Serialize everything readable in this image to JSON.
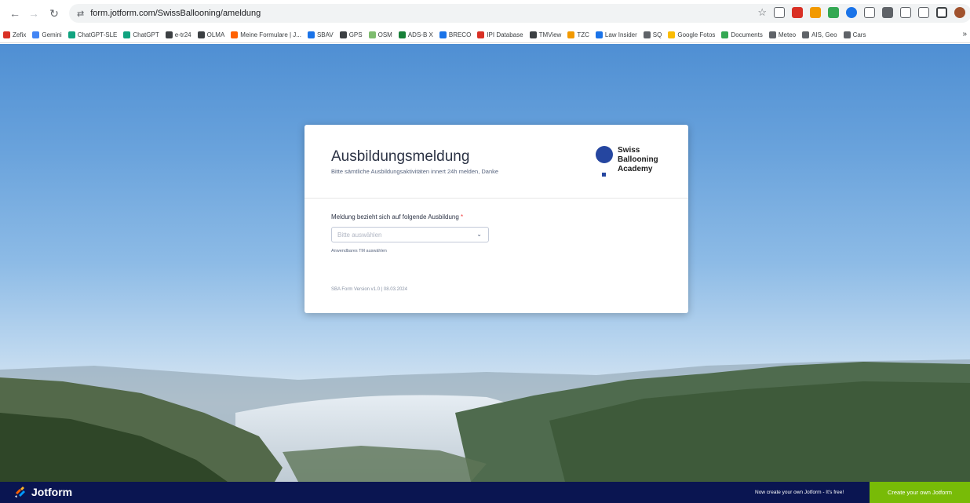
{
  "browser": {
    "url": "form.jotform.com/SwissBallooning/ameldung",
    "bookmarks": [
      {
        "label": "Zefix",
        "color": "#d93025"
      },
      {
        "label": "Gemini",
        "color": "#4285f4"
      },
      {
        "label": "ChatGPT-SLE",
        "color": "#10a37f"
      },
      {
        "label": "ChatGPT",
        "color": "#10a37f"
      },
      {
        "label": "e-tr24",
        "color": "#3c4043"
      },
      {
        "label": "OLMA",
        "color": "#3c4043"
      },
      {
        "label": "Meine Formulare | J...",
        "color": "#ff6100"
      },
      {
        "label": "SBAV",
        "color": "#1a73e8"
      },
      {
        "label": "GPS",
        "color": "#3c4043"
      },
      {
        "label": "OSM",
        "color": "#7ebc6f"
      },
      {
        "label": "ADS-B X",
        "color": "#188038"
      },
      {
        "label": "BRECO",
        "color": "#1a73e8"
      },
      {
        "label": "IPI Database",
        "color": "#d93025"
      },
      {
        "label": "TMView",
        "color": "#3c4043"
      },
      {
        "label": "TZC",
        "color": "#f29900"
      },
      {
        "label": "Law Insider",
        "color": "#1a73e8"
      },
      {
        "label": "SQ",
        "color": "#5f6368"
      },
      {
        "label": "Google Fotos",
        "color": "#fbbc04"
      },
      {
        "label": "Documents",
        "color": "#34a853"
      },
      {
        "label": "Meteo",
        "color": "#5f6368"
      },
      {
        "label": "AIS, Geo",
        "color": "#5f6368"
      },
      {
        "label": "Cars",
        "color": "#5f6368"
      }
    ],
    "more_label": "»"
  },
  "form": {
    "title": "Ausbildungsmeldung",
    "subtitle": "Bitte sämtliche Ausbildungsaktivitäten innert 24h melden, Danke",
    "logo_lines": [
      "Swiss",
      "Ballooning",
      "Academy"
    ],
    "field_label": "Meldung bezieht sich auf folgende Ausbildung",
    "required_mark": "*",
    "select_placeholder": "Bitte auswählen",
    "field_hint": "Anwendbares TM auswählen",
    "version": "SBA Form Version v1.0 | 08.03.2024"
  },
  "footer": {
    "brand": "Jotform",
    "promo_text": "Now create your own Jotform - It's free!",
    "cta_label": "Create your own Jotform"
  },
  "colors": {
    "brand_blue": "#2546a0",
    "jotform_navy": "#0a1551",
    "cta_green": "#78bb07"
  }
}
